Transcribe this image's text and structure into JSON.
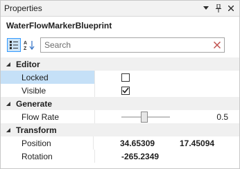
{
  "window": {
    "title": "Properties",
    "icons": [
      "chevron-down-icon",
      "pin-icon",
      "close-icon"
    ]
  },
  "object_name": "WaterFlowMarkerBlueprint",
  "toolbar": {
    "categorized_icon": "categorized-view-icon",
    "alphabetical_icon": "alphabetical-sort-icon",
    "search_placeholder": "Search",
    "clear_icon": "clear-search-icon"
  },
  "categories": {
    "editor": {
      "label": "Editor",
      "locked": {
        "label": "Locked",
        "checked": false
      },
      "visible": {
        "label": "Visible",
        "checked": true
      }
    },
    "generate": {
      "label": "Generate",
      "flow_rate": {
        "label": "Flow Rate",
        "value": "0.5",
        "slider_fraction": 0.5
      }
    },
    "transform": {
      "label": "Transform",
      "position": {
        "label": "Position",
        "x": "34.65309",
        "y": "17.45094"
      },
      "rotation": {
        "label": "Rotation",
        "value": "-265.2349"
      }
    }
  },
  "colors": {
    "selection": "#c5e0f7",
    "accent": "#3399ff",
    "category_background": "#f0f0f0",
    "clear_icon": "#c0504d"
  }
}
